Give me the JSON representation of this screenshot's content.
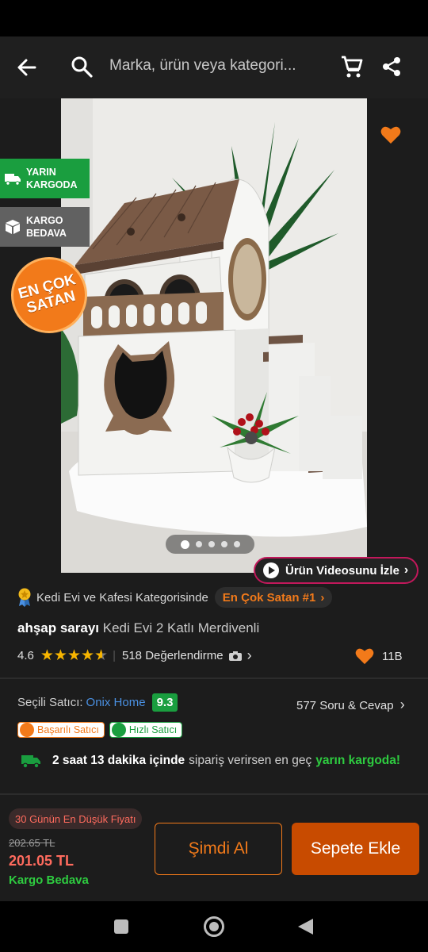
{
  "header": {
    "search_placeholder": "Marka, ürün veya kategori..."
  },
  "gallery": {
    "tags": {
      "next_day": "YARIN KARGODA",
      "free_shipping": "KARGO BEDAVA"
    },
    "best_seller_badge": "EN ÇOK SATAN",
    "image_count": 5,
    "active_image": 1,
    "video_button": "Ürün Videosunu İzle"
  },
  "product": {
    "category_text": "Kedi Evi ve Kafesi Kategorisinde",
    "rank_label": "En Çok Satan #1",
    "brand": "ahşap sarayı",
    "name": "Kedi Evi 2 Katlı Merdivenli",
    "rating": "4.6",
    "rating_value": 4.6,
    "reviews": "518 Değerlendirme",
    "favorites": "11B"
  },
  "seller": {
    "label": "Seçili Satıcı:",
    "name": "Onix Home",
    "score": "9.3",
    "qa": "577 Soru & Cevap",
    "badges": [
      "Başarılı Satıcı",
      "Hızlı Satıcı"
    ]
  },
  "delivery": {
    "time": "2 saat 13 dakika içinde",
    "middle": "sipariş verirsen en geç",
    "when": "yarın kargoda!"
  },
  "price": {
    "lowest_label": "30 Günün En Düşük Fiyatı",
    "old": "202.65 TL",
    "current": "201.05 TL",
    "shipping": "Kargo Bedava"
  },
  "actions": {
    "buy_now": "Şimdi Al",
    "add_to_cart": "Sepete Ekle"
  },
  "colors": {
    "accent": "#f27a1a",
    "success": "#1a9e3f",
    "price": "#ff6b5e"
  }
}
